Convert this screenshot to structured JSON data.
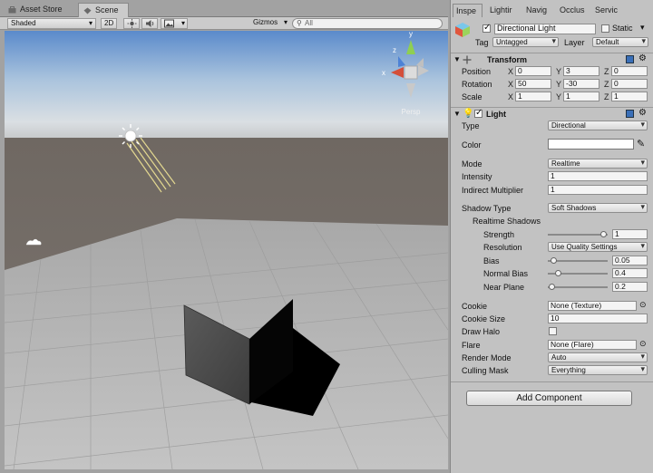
{
  "scene_tabs": [
    {
      "label": "Asset Store"
    },
    {
      "label": "Scene"
    }
  ],
  "scene_toolbar": {
    "shading_mode": "Shaded",
    "mode_2d": "2D",
    "gizmos": "Gizmos",
    "search_placeholder": "All"
  },
  "gizmo": {
    "axes": {
      "x": "x",
      "y": "y",
      "z": "z"
    },
    "view_label": "Persp"
  },
  "inspector_tabs": [
    {
      "label": "Inspe"
    },
    {
      "label": "Lightir"
    },
    {
      "label": "Navig"
    },
    {
      "label": "Occlus"
    },
    {
      "label": "Servic"
    }
  ],
  "object": {
    "name": "Directional Light",
    "static_label": "Static",
    "tag_label": "Tag",
    "tag_value": "Untagged",
    "layer_label": "Layer",
    "layer_value": "Default"
  },
  "transform": {
    "title": "Transform",
    "position_label": "Position",
    "rotation_label": "Rotation",
    "scale_label": "Scale",
    "axis_x": "X",
    "axis_y": "Y",
    "axis_z": "Z",
    "position": {
      "x": "0",
      "y": "3",
      "z": "0"
    },
    "rotation": {
      "x": "50",
      "y": "-30",
      "z": "0"
    },
    "scale": {
      "x": "1",
      "y": "1",
      "z": "1"
    }
  },
  "light": {
    "title": "Light",
    "type_label": "Type",
    "type_value": "Directional",
    "color_label": "Color",
    "mode_label": "Mode",
    "mode_value": "Realtime",
    "intensity_label": "Intensity",
    "intensity_value": "1",
    "indirect_label": "Indirect Multiplier",
    "indirect_value": "1",
    "shadow_type_label": "Shadow Type",
    "shadow_type_value": "Soft Shadows",
    "realtime_shadows_label": "Realtime Shadows",
    "strength_label": "Strength",
    "strength_value": "1",
    "resolution_label": "Resolution",
    "resolution_value": "Use Quality Settings",
    "bias_label": "Bias",
    "bias_value": "0.05",
    "normal_bias_label": "Normal Bias",
    "normal_bias_value": "0.4",
    "near_plane_label": "Near Plane",
    "near_plane_value": "0.2",
    "cookie_label": "Cookie",
    "cookie_value": "None (Texture)",
    "cookie_size_label": "Cookie Size",
    "cookie_size_value": "10",
    "draw_halo_label": "Draw Halo",
    "flare_label": "Flare",
    "flare_value": "None (Flare)",
    "render_mode_label": "Render Mode",
    "render_mode_value": "Auto",
    "culling_mask_label": "Culling Mask",
    "culling_mask_value": "Everything"
  },
  "add_component_label": "Add Component",
  "sliders": {
    "strength": 1.0,
    "bias": 0.05,
    "normal_bias": 0.13,
    "near_plane": 0.02
  },
  "colors": {
    "light_color": "#ffffff",
    "sky_top": "#5d8dc9",
    "ground": "#b5b5b5"
  }
}
